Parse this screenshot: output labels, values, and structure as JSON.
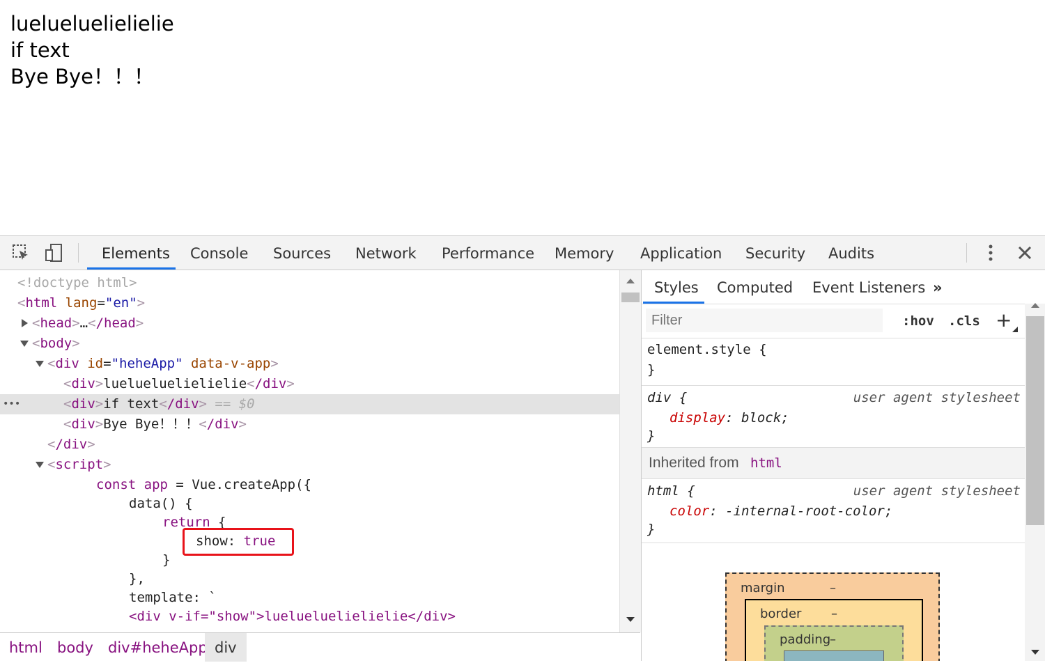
{
  "page": {
    "lines": [
      "luelueluelielielie",
      "if text",
      "Bye Bye！！！"
    ]
  },
  "toolbar": {
    "tabs": [
      "Elements",
      "Console",
      "Sources",
      "Network",
      "Performance",
      "Memory",
      "Application",
      "Security",
      "Audits"
    ],
    "active_tab": "Elements"
  },
  "elements": {
    "doctype": "<!doctype html>",
    "html_open": {
      "tag": "html",
      "attr": "lang",
      "val": "\"en\""
    },
    "head": {
      "open": "head",
      "ellipsis": "…",
      "close": "/head"
    },
    "body_tag": "body",
    "div_app": {
      "tag": "div",
      "attr1": "id",
      "val1": "\"heheApp\"",
      "attr2": "data-v-app"
    },
    "div1_text": "luelueluelielielie",
    "div2_text": "if text",
    "div2_suffix": " == $0",
    "div3_text": "Bye Bye！！！",
    "div_tag": "div",
    "div_close": "/div",
    "script_tag": "script",
    "code": {
      "const": "const",
      "app": "app",
      "eq": " = ",
      "create": "Vue.createApp({",
      "data": "data() {",
      "return": "return",
      "brace_open": " {",
      "show_key": "show:",
      "show_val": "true",
      "brace_close": "}",
      "data_close": "},",
      "template": "template: `",
      "template_line": "<div v-if=\"show\">luelueluelielielie</div>"
    },
    "selected_marker": "•••"
  },
  "breadcrumbs": [
    "html",
    "body",
    "div#heheApp",
    "div"
  ],
  "styles": {
    "tabs": [
      "Styles",
      "Computed",
      "Event Listeners"
    ],
    "more": "»",
    "filter_placeholder": "Filter",
    "hov": ":hov",
    "cls": ".cls",
    "plus": "+",
    "element_style": "element.style {",
    "close_brace": "}",
    "div_rule": {
      "selector": "div {",
      "source": "user agent stylesheet",
      "prop": "display",
      "value": " block;"
    },
    "inherited_label": "Inherited from ",
    "inherited_tag": "html",
    "html_rule": {
      "selector": "html {",
      "source": "user agent stylesheet",
      "prop": "color",
      "value": " -internal-root-color;"
    },
    "box_model": {
      "margin": "margin",
      "border": "border",
      "padding": "padding",
      "dash": "–"
    }
  }
}
